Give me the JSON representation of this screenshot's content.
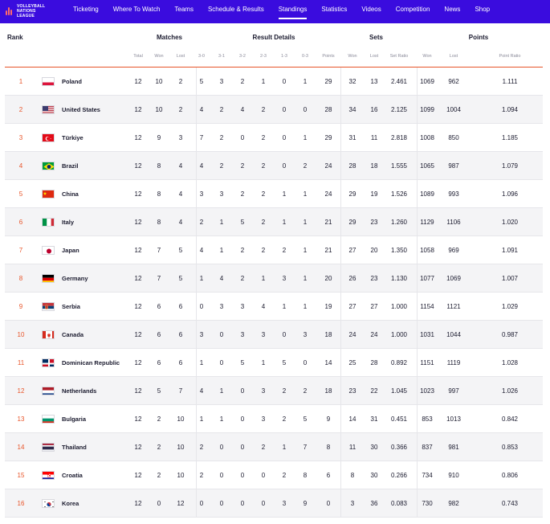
{
  "nav": {
    "logo_line1": "VOLLEYBALL",
    "logo_line2": "NATIONS LEAGUE",
    "items": [
      "Ticketing",
      "Where To Watch",
      "Teams",
      "Schedule & Results",
      "Standings",
      "Statistics",
      "Videos",
      "Competition",
      "News",
      "Shop"
    ],
    "active": "Standings"
  },
  "headers": {
    "rank": "Rank",
    "matches": "Matches",
    "result_details": "Result Details",
    "sets": "Sets",
    "points": "Points",
    "sub": [
      "Total",
      "Won",
      "Lost",
      "3-0",
      "3-1",
      "3-2",
      "2-3",
      "1-3",
      "0-3",
      "Points",
      "Won",
      "Lost",
      "Set Ratio",
      "Won",
      "Lost",
      "Point Ratio"
    ]
  },
  "rows": [
    {
      "rank": "1",
      "team": "Poland",
      "flag": "poland",
      "v": [
        "12",
        "10",
        "2",
        "5",
        "3",
        "2",
        "1",
        "0",
        "1",
        "29",
        "32",
        "13",
        "2.461",
        "1069",
        "962",
        "1.111"
      ]
    },
    {
      "rank": "2",
      "team": "United States",
      "flag": "usa",
      "v": [
        "12",
        "10",
        "2",
        "4",
        "2",
        "4",
        "2",
        "0",
        "0",
        "28",
        "34",
        "16",
        "2.125",
        "1099",
        "1004",
        "1.094"
      ]
    },
    {
      "rank": "3",
      "team": "Türkiye",
      "flag": "turkiye",
      "v": [
        "12",
        "9",
        "3",
        "7",
        "2",
        "0",
        "2",
        "0",
        "1",
        "29",
        "31",
        "11",
        "2.818",
        "1008",
        "850",
        "1.185"
      ]
    },
    {
      "rank": "4",
      "team": "Brazil",
      "flag": "brazil",
      "v": [
        "12",
        "8",
        "4",
        "4",
        "2",
        "2",
        "2",
        "0",
        "2",
        "24",
        "28",
        "18",
        "1.555",
        "1065",
        "987",
        "1.079"
      ]
    },
    {
      "rank": "5",
      "team": "China",
      "flag": "china",
      "v": [
        "12",
        "8",
        "4",
        "3",
        "3",
        "2",
        "2",
        "1",
        "1",
        "24",
        "29",
        "19",
        "1.526",
        "1089",
        "993",
        "1.096"
      ]
    },
    {
      "rank": "6",
      "team": "Italy",
      "flag": "italy",
      "v": [
        "12",
        "8",
        "4",
        "2",
        "1",
        "5",
        "2",
        "1",
        "1",
        "21",
        "29",
        "23",
        "1.260",
        "1129",
        "1106",
        "1.020"
      ]
    },
    {
      "rank": "7",
      "team": "Japan",
      "flag": "japan",
      "v": [
        "12",
        "7",
        "5",
        "4",
        "1",
        "2",
        "2",
        "2",
        "1",
        "21",
        "27",
        "20",
        "1.350",
        "1058",
        "969",
        "1.091"
      ]
    },
    {
      "rank": "8",
      "team": "Germany",
      "flag": "germany",
      "v": [
        "12",
        "7",
        "5",
        "1",
        "4",
        "2",
        "1",
        "3",
        "1",
        "20",
        "26",
        "23",
        "1.130",
        "1077",
        "1069",
        "1.007"
      ]
    },
    {
      "rank": "9",
      "team": "Serbia",
      "flag": "serbia",
      "v": [
        "12",
        "6",
        "6",
        "0",
        "3",
        "3",
        "4",
        "1",
        "1",
        "19",
        "27",
        "27",
        "1.000",
        "1154",
        "1121",
        "1.029"
      ]
    },
    {
      "rank": "10",
      "team": "Canada",
      "flag": "canada",
      "v": [
        "12",
        "6",
        "6",
        "3",
        "0",
        "3",
        "3",
        "0",
        "3",
        "18",
        "24",
        "24",
        "1.000",
        "1031",
        "1044",
        "0.987"
      ]
    },
    {
      "rank": "11",
      "team": "Dominican Republic",
      "flag": "dominican",
      "v": [
        "12",
        "6",
        "6",
        "1",
        "0",
        "5",
        "1",
        "5",
        "0",
        "14",
        "25",
        "28",
        "0.892",
        "1151",
        "1119",
        "1.028"
      ]
    },
    {
      "rank": "12",
      "team": "Netherlands",
      "flag": "netherlands",
      "v": [
        "12",
        "5",
        "7",
        "4",
        "1",
        "0",
        "3",
        "2",
        "2",
        "18",
        "23",
        "22",
        "1.045",
        "1023",
        "997",
        "1.026"
      ]
    },
    {
      "rank": "13",
      "team": "Bulgaria",
      "flag": "bulgaria",
      "v": [
        "12",
        "2",
        "10",
        "1",
        "1",
        "0",
        "3",
        "2",
        "5",
        "9",
        "14",
        "31",
        "0.451",
        "853",
        "1013",
        "0.842"
      ]
    },
    {
      "rank": "14",
      "team": "Thailand",
      "flag": "thailand",
      "v": [
        "12",
        "2",
        "10",
        "2",
        "0",
        "0",
        "2",
        "1",
        "7",
        "8",
        "11",
        "30",
        "0.366",
        "837",
        "981",
        "0.853"
      ]
    },
    {
      "rank": "15",
      "team": "Croatia",
      "flag": "croatia",
      "v": [
        "12",
        "2",
        "10",
        "2",
        "0",
        "0",
        "0",
        "2",
        "8",
        "6",
        "8",
        "30",
        "0.266",
        "734",
        "910",
        "0.806"
      ]
    },
    {
      "rank": "16",
      "team": "Korea",
      "flag": "korea",
      "v": [
        "12",
        "0",
        "12",
        "0",
        "0",
        "0",
        "0",
        "3",
        "9",
        "0",
        "3",
        "36",
        "0.083",
        "730",
        "982",
        "0.743"
      ]
    }
  ]
}
